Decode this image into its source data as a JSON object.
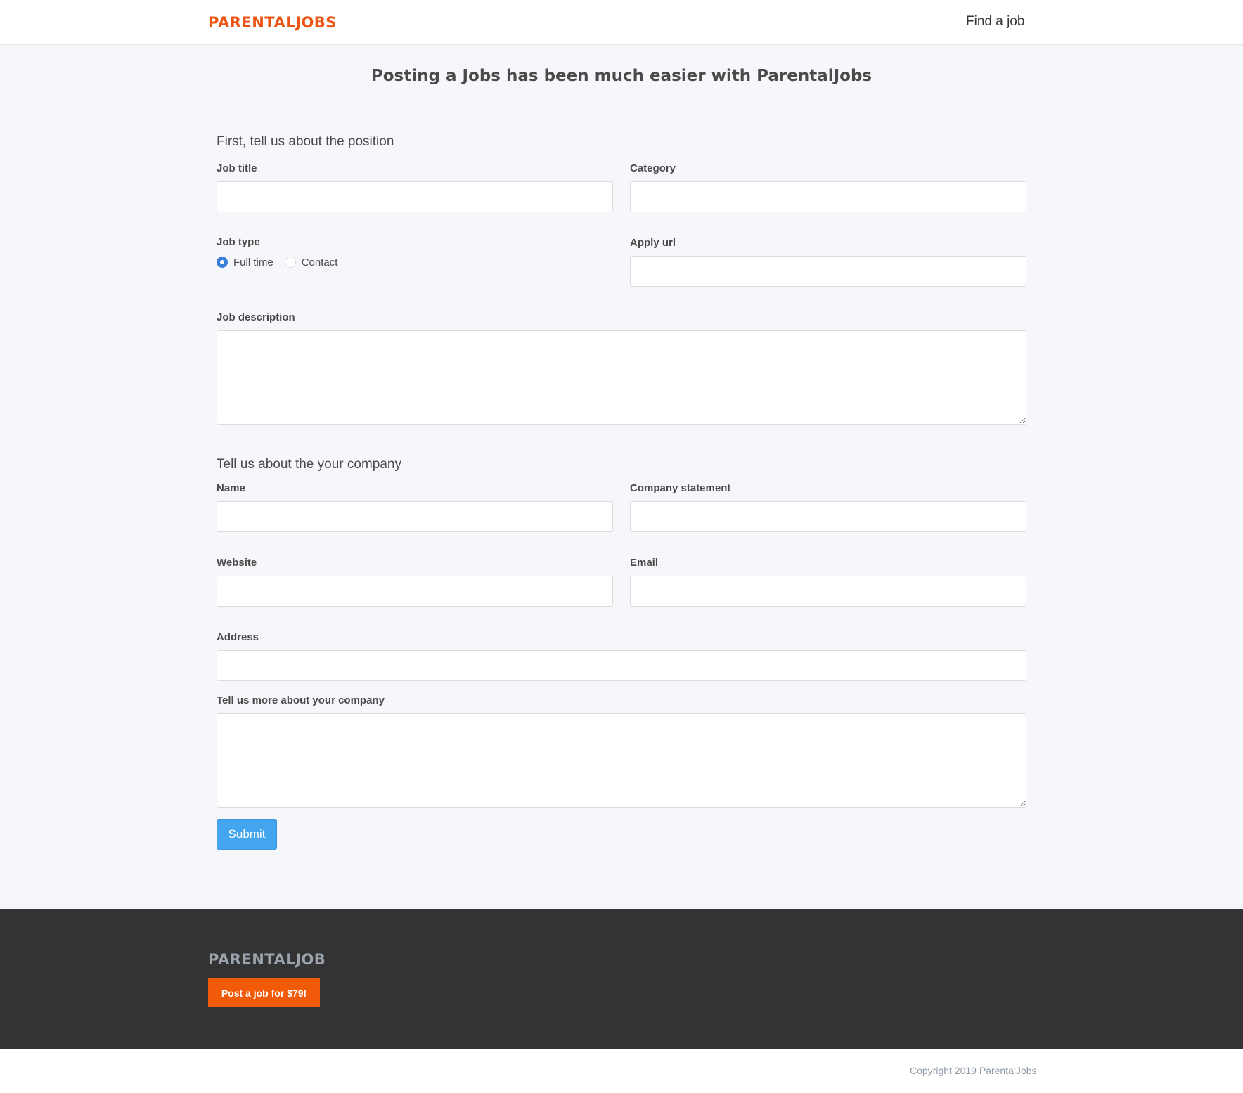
{
  "header": {
    "brand": "PARENTALJOBS",
    "nav_find_job": "Find a job"
  },
  "page": {
    "title": "Posting a Jobs has been much easier with ParentalJobs"
  },
  "position_section": {
    "title": "First, tell us about the position",
    "job_title_label": "Job title",
    "job_title_value": "",
    "category_label": "Category",
    "category_value": "",
    "job_type_label": "Job type",
    "job_type_options": [
      "Full time",
      "Contact"
    ],
    "job_type_selected": "Full time",
    "apply_url_label": "Apply url",
    "apply_url_value": "",
    "description_label": "Job description",
    "description_value": ""
  },
  "company_section": {
    "title": "Tell us about the your company",
    "name_label": "Name",
    "name_value": "",
    "statement_label": "Company statement",
    "statement_value": "",
    "website_label": "Website",
    "website_value": "",
    "email_label": "Email",
    "email_value": "",
    "address_label": "Address",
    "address_value": "",
    "more_label": "Tell us more about your company",
    "more_value": ""
  },
  "form": {
    "submit_label": "Submit"
  },
  "footer": {
    "brand": "PARENTALJOB",
    "cta_label": "Post a job for $79!",
    "copyright": "Copyright 2019 ParentalJobs"
  },
  "colors": {
    "brand": "#ec5414",
    "cta": "#f15a08",
    "submit": "#42a5ee",
    "radio_checked": "#3b7ed9",
    "footer_bg": "#333333",
    "page_bg": "#f5f7fa"
  }
}
